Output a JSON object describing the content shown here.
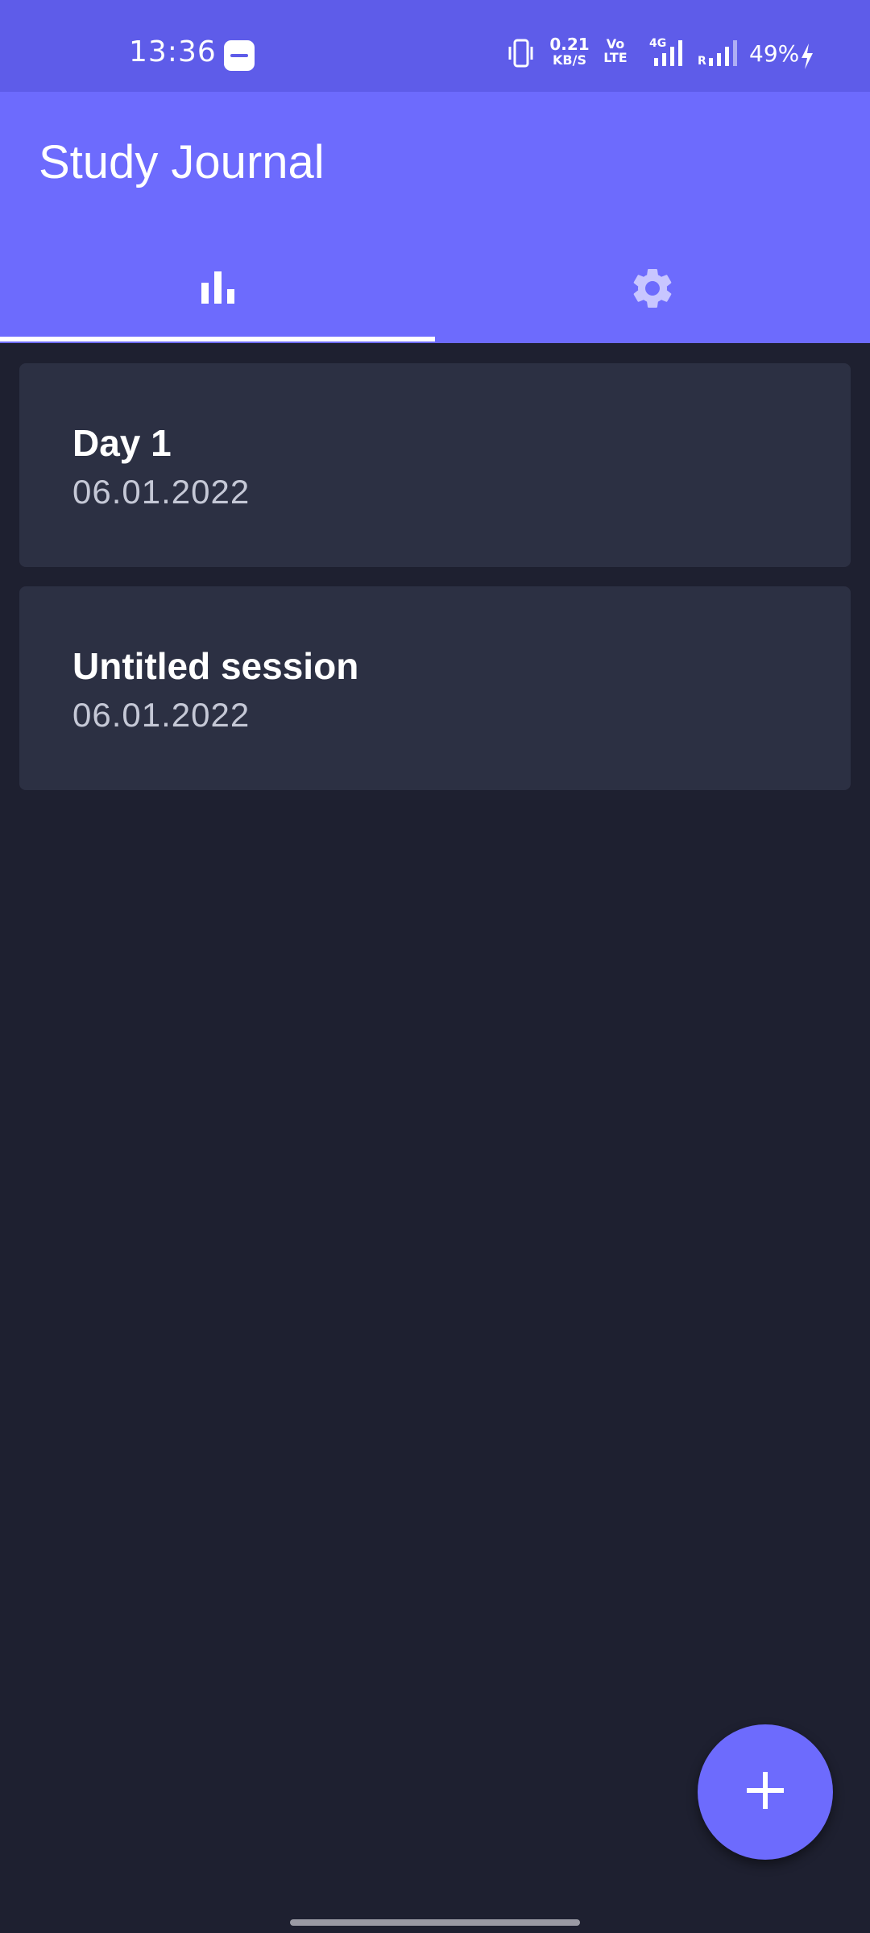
{
  "status_bar": {
    "time": "13:36",
    "net_speed_value": "0.21",
    "net_speed_unit": "KB/S",
    "volte_top": "Vo",
    "volte_bottom": "LTE",
    "network_type": "4G",
    "roaming": "R",
    "battery": "49%"
  },
  "app_bar": {
    "title": "Study Journal",
    "tabs": [
      {
        "name": "statistics",
        "icon": "bar-chart-icon",
        "selected": true
      },
      {
        "name": "settings",
        "icon": "gear-icon",
        "selected": false
      }
    ]
  },
  "sessions": [
    {
      "title": "Day 1",
      "date": "06.01.2022"
    },
    {
      "title": "Untitled session",
      "date": "06.01.2022"
    }
  ],
  "fab": {
    "icon": "plus-icon"
  },
  "colors": {
    "status_bar": "#5e5ce9",
    "app_bar": "#6d6bfd",
    "background": "#1e2030",
    "card": "#2c3043",
    "accent": "#6d6bfd"
  }
}
